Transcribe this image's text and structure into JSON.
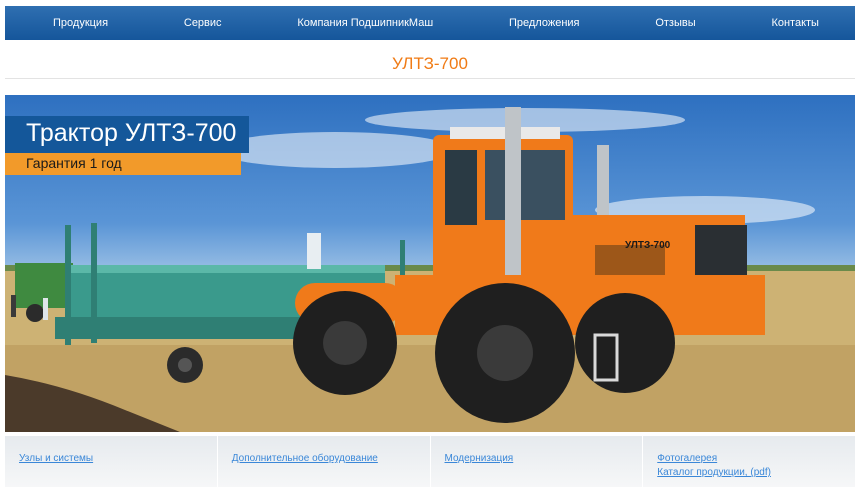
{
  "nav": {
    "items": [
      {
        "label": "Продукция"
      },
      {
        "label": "Сервис"
      },
      {
        "label": "Компания ПодшипникМаш"
      },
      {
        "label": "Предложения"
      },
      {
        "label": "Отзывы"
      },
      {
        "label": "Контакты"
      }
    ]
  },
  "page": {
    "title": "УЛТЗ-700"
  },
  "hero": {
    "title": "Трактор УЛТЗ-700",
    "subtitle": "Гарантия 1 год",
    "tractor_label": "УЛТЗ-700",
    "colors": {
      "tractor": "#f07a1a",
      "seeder": "#3a9a8c",
      "caption_bg": "#14579a",
      "caption_accent": "#f29a2a"
    }
  },
  "bottom": {
    "links": [
      {
        "label": "Узлы и системы"
      },
      {
        "label": "Дополнительное оборудование"
      },
      {
        "label": "Модернизация"
      },
      {
        "label": "Фотогалерея"
      },
      {
        "label": "Каталог продукции, (pdf)"
      }
    ]
  }
}
